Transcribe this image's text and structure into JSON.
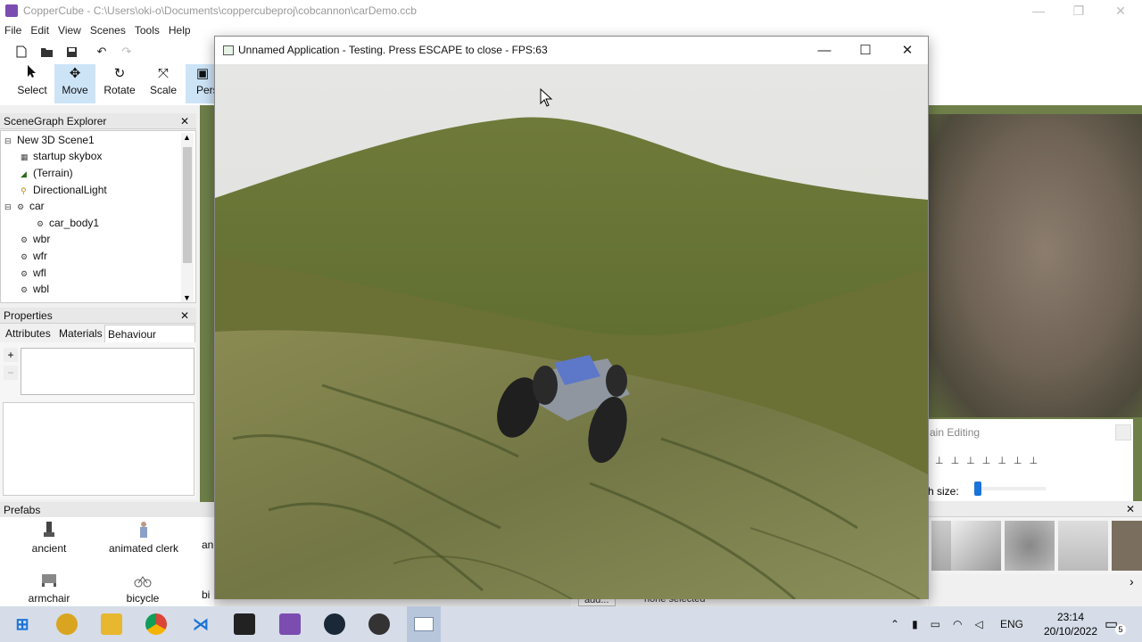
{
  "main_window": {
    "title": "CopperCube - C:\\Users\\oki-o\\Documents\\coppercubeproj\\cobcannon\\carDemo.ccb",
    "minimize": "—",
    "maximize": "❐",
    "close": "✕"
  },
  "menu": [
    "File",
    "Edit",
    "View",
    "Scenes",
    "Tools",
    "Help"
  ],
  "toolbar": {
    "tools": [
      {
        "label": "Select",
        "icon": "arrow-icon"
      },
      {
        "label": "Move",
        "icon": "move-icon"
      },
      {
        "label": "Rotate",
        "icon": "rotate-icon"
      },
      {
        "label": "Scale",
        "icon": "scale-icon"
      },
      {
        "label": "Pers",
        "icon": "perspective-icon"
      }
    ],
    "active_tool": "Move"
  },
  "scenegraph": {
    "header": "SceneGraph Explorer",
    "close": "✕",
    "items": [
      {
        "label": "New 3D Scene1",
        "icon": "",
        "expander": "⊟"
      },
      {
        "label": "startup skybox",
        "icon": "skybox-icon"
      },
      {
        "label": "(Terrain)",
        "icon": "terrain-icon"
      },
      {
        "label": "DirectionalLight",
        "icon": "light-icon"
      },
      {
        "label": "car",
        "icon": "mesh-icon",
        "expander": "⊟"
      },
      {
        "label": "car_body1",
        "icon": "mesh-icon"
      },
      {
        "label": "wbr",
        "icon": "mesh-icon"
      },
      {
        "label": "wfr",
        "icon": "mesh-icon"
      },
      {
        "label": "wfl",
        "icon": "mesh-icon"
      },
      {
        "label": "wbl",
        "icon": "mesh-icon"
      }
    ]
  },
  "properties": {
    "header": "Properties",
    "close": "✕",
    "tabs": [
      "Attributes",
      "Materials",
      "Behaviour"
    ],
    "active_tab": "Behaviour",
    "add": "+",
    "remove": "−"
  },
  "prefabs": {
    "header": "Prefabs",
    "items": [
      {
        "label": "ancient"
      },
      {
        "label": "animated clerk"
      },
      {
        "label": "an"
      },
      {
        "label": "armchair"
      },
      {
        "label": "bicycle"
      },
      {
        "label": "bi"
      }
    ]
  },
  "terrain_panel": {
    "title": "ain Editing",
    "brush_label": "h size:",
    "brush_size_fraction": 0.0
  },
  "texture_strip": {
    "close": "✕",
    "next": "›"
  },
  "bottom_status": {
    "add": "add...",
    "selection": "none selected"
  },
  "test_window": {
    "title": "Unnamed Application - Testing. Press ESCAPE to close - FPS:63",
    "minimize": "—",
    "maximize": "☐",
    "close": "✕"
  },
  "taskbar": {
    "apps": [
      "start-icon",
      "chrome-canary-icon",
      "file-explorer-icon",
      "chrome-icon",
      "vscode-icon",
      "terminal-icon",
      "coppercube-icon",
      "steam-icon",
      "obs-icon",
      "app-window-icon"
    ],
    "language": "ENG",
    "time": "23:14",
    "date": "20/10/2022",
    "notifications": "5"
  }
}
